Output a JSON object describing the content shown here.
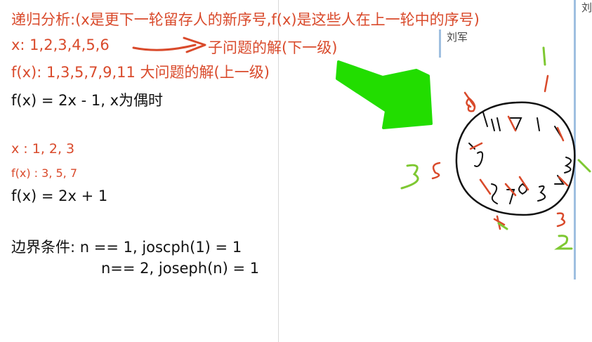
{
  "notes": {
    "line1": "递归分析:(x是更下一轮留存人的新序号,f(x)是这些人在上一轮中的序号)",
    "line2_label": "x:   1,2,3,4,5,6",
    "line2_note": "子问题的解(下一级)",
    "line3": "f(x): 1,3,5,7,9,11  大问题的解(上一级)",
    "line4": "f(x) = 2x - 1,  x为偶时",
    "line5": "x  :  1, 2, 3",
    "line6": "f(x) :  3, 5, 7",
    "line7": "f(x) = 2x + 1",
    "line8": "边界条件: n == 1, joscph(1) = 1",
    "line9": "n== 2, joseph(n) = 1"
  },
  "tabs": {
    "author_tab": "刘军",
    "right_tab": "刘"
  },
  "colors": {
    "red_ink": "#d94a2b",
    "green_ink": "#22dd00",
    "sketch_green": "#7ec832",
    "tab_blue": "#9fbfe0"
  }
}
